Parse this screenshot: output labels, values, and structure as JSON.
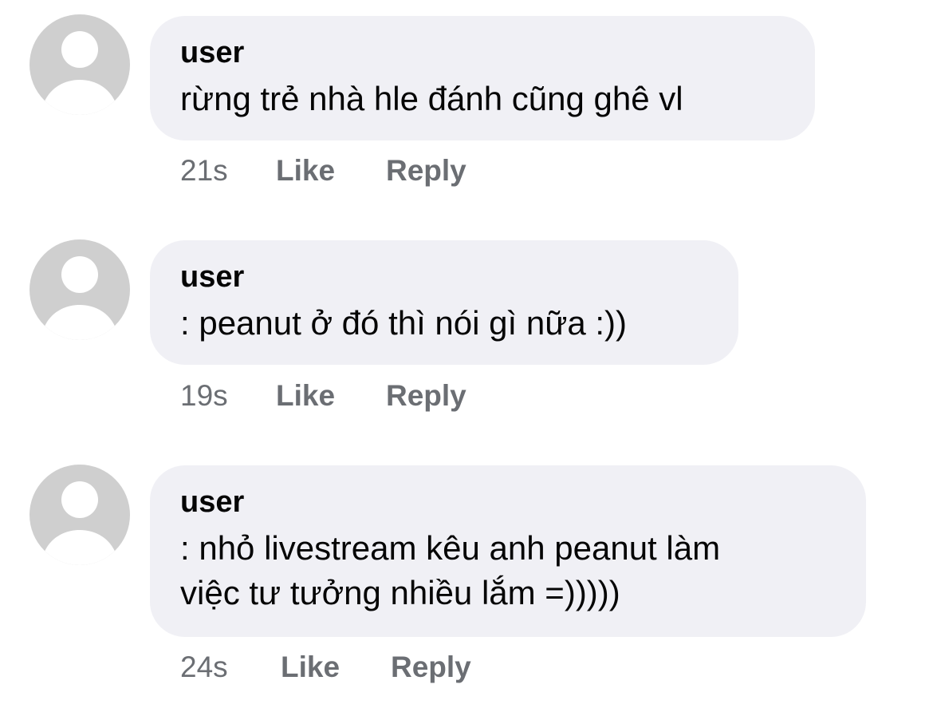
{
  "comments": [
    {
      "author": "user",
      "text": "rừng trẻ nhà hle đánh cũng ghê vl",
      "time": "21s",
      "like_label": "Like",
      "reply_label": "Reply"
    },
    {
      "author": "user",
      "text": ": peanut ở đó thì nói gì nữa :))",
      "time": "19s",
      "like_label": "Like",
      "reply_label": "Reply"
    },
    {
      "author": "user",
      "text_line1": ": nhỏ livestream kêu anh peanut làm",
      "text_line2": "việc tư tưởng nhiều lắm =)))))",
      "time": "24s",
      "like_label": "Like",
      "reply_label": "Reply"
    }
  ],
  "colors": {
    "bubble": "#f0f0f5",
    "avatar_bg": "#cfcfcf",
    "avatar_fg": "#ffffff",
    "meta_text": "#6b6e73"
  }
}
